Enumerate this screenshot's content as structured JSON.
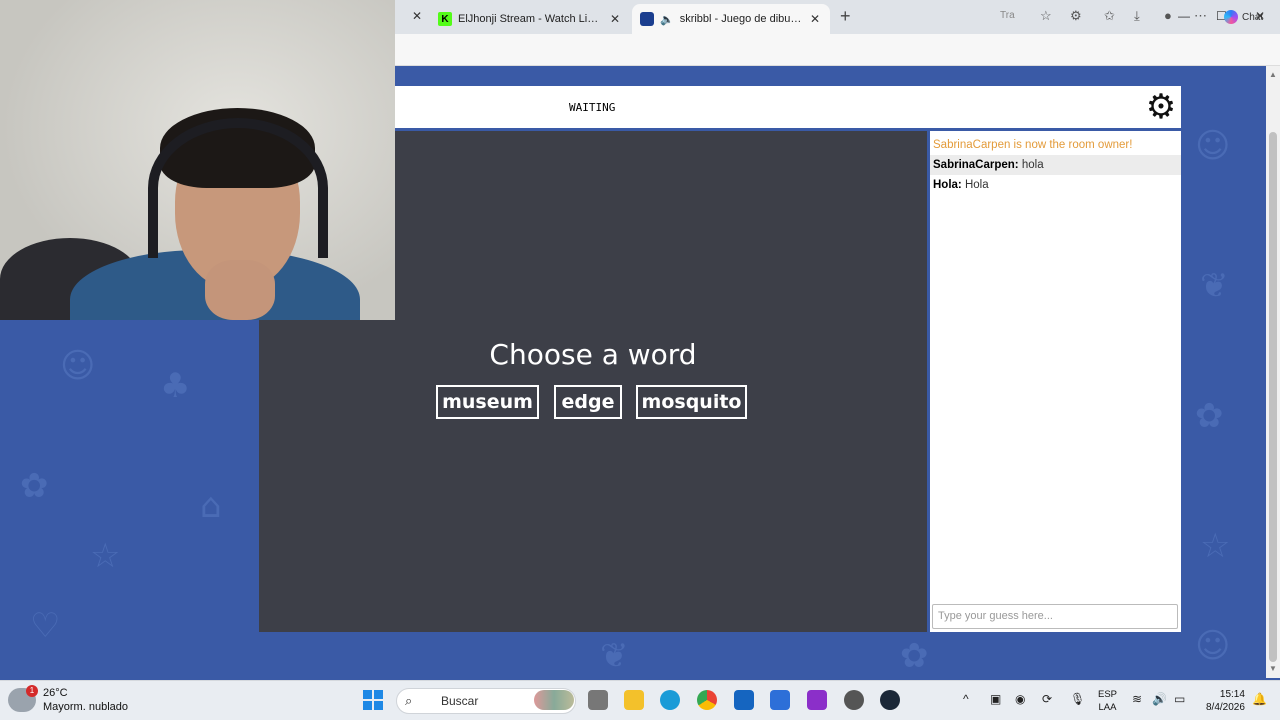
{
  "browser": {
    "tabs": [
      {
        "title": "ElJhonji Stream - Watch Live on Ki",
        "favicon": "kick-icon"
      },
      {
        "title": "skribbl - Juego de dibujo y ad",
        "favicon": "skribbl-icon",
        "active": true
      }
    ],
    "toolbar": {
      "translate_label": "Tra",
      "chat_label": "Chat"
    }
  },
  "game": {
    "status": "WAITING",
    "prompt": "Choose a word",
    "words": [
      "museum",
      "edge",
      "mosquito"
    ],
    "chat": [
      {
        "type": "system",
        "text": "SabrinaCarpen is now the room owner!"
      },
      {
        "type": "user",
        "user": "SabrinaCarpen:",
        "text": "hola"
      },
      {
        "type": "user",
        "user": "Hola:",
        "text": "Hola"
      }
    ],
    "guess_placeholder": "Type your guess here..."
  },
  "taskbar": {
    "weather_temp": "26°C",
    "weather_desc": "Mayorm. nublado",
    "weather_badge": "1",
    "search_label": "Buscar",
    "lang_top": "ESP",
    "lang_bottom": "LAA",
    "time": "15:14",
    "date": "8/4/2026"
  },
  "colors": {
    "page_bg": "#3a5aa6",
    "canvas_bg": "#3d3f48",
    "system_msg": "#e39b3a"
  }
}
